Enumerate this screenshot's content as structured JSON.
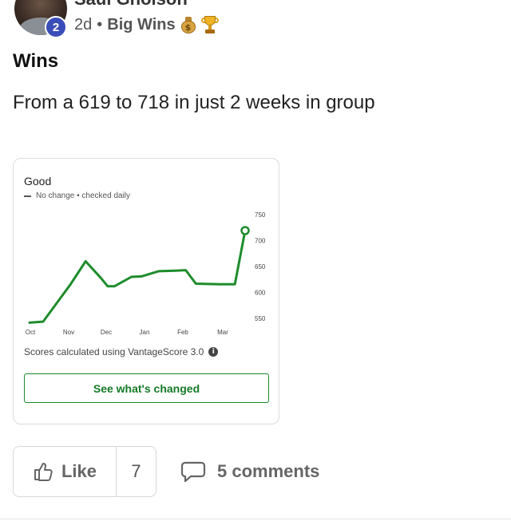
{
  "post": {
    "author_name": "Saul Gholson",
    "level": "2",
    "age": "2d",
    "group": "Big Wins",
    "emojis": [
      "money-bag",
      "trophy"
    ],
    "title": "Wins",
    "body": "From a 619 to 718 in just 2 weeks in group"
  },
  "card": {
    "rating": "Good",
    "legend": "No change • checked daily",
    "footnote": "Scores calculated using VantageScore 3.0",
    "info_glyph": "i",
    "button_label": "See what's changed"
  },
  "chart_data": {
    "type": "line",
    "title": "",
    "xlabel": "",
    "ylabel": "",
    "x_ticks": [
      "Oct",
      "Nov",
      "Dec",
      "Jan",
      "Feb",
      "Mar"
    ],
    "y_ticks": [
      750,
      700,
      650,
      600,
      550
    ],
    "ylim": [
      535,
      765
    ],
    "grid": false,
    "line_color": "#1e8c2b",
    "series": [
      {
        "x": [
          0,
          0.4,
          1.2,
          1.65,
          2.1,
          2.3,
          2.5,
          3.0,
          3.3,
          3.8,
          4.3,
          4.6,
          4.9,
          5.6,
          6.05,
          6.35
        ],
        "y": [
          542,
          544,
          615,
          660,
          628,
          612,
          612,
          630,
          631,
          641,
          642,
          643,
          617,
          616,
          616,
          719
        ],
        "end_marker": true
      }
    ]
  },
  "actions": {
    "like_label": "Like",
    "like_count": "7",
    "comments_label": "5 comments"
  },
  "colors": {
    "accent_green": "#1e8c2b",
    "badge_blue": "#3b4db8"
  }
}
